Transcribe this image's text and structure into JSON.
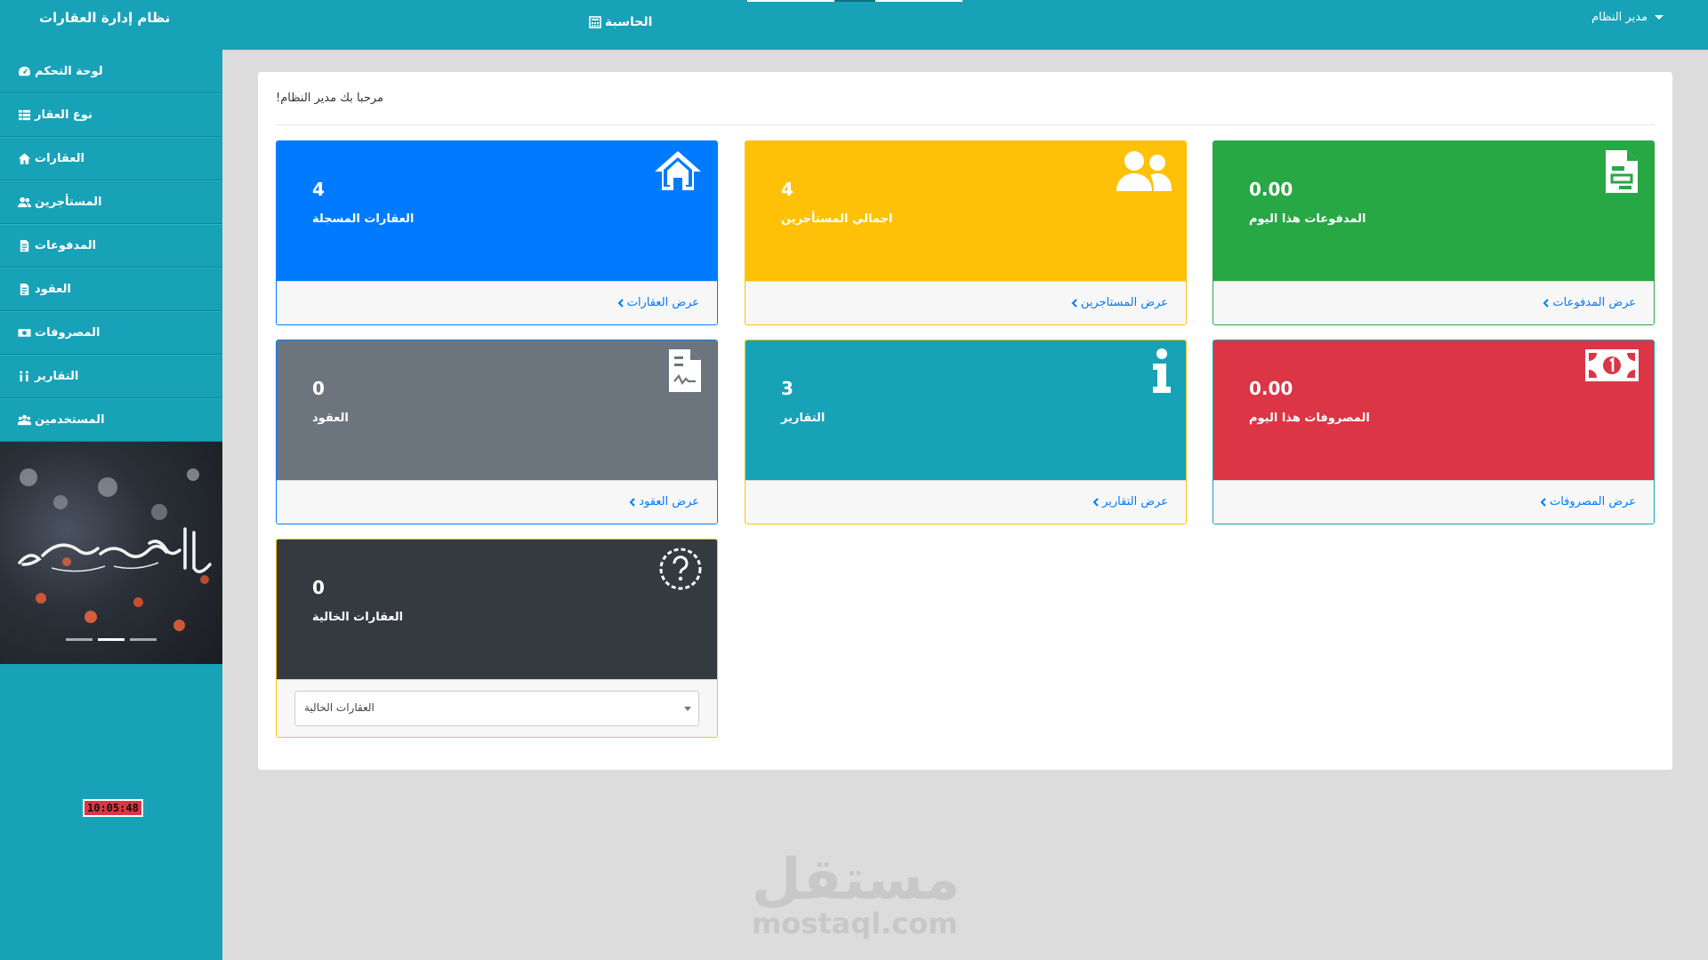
{
  "topbar": {
    "brand": "نظام إدارة العقارات",
    "calculator": "الحاسبة",
    "user": "مدير النظام",
    "colors": {
      "bar": "#17a2b8"
    }
  },
  "sidebar": {
    "items": [
      {
        "label": "لوحة التحكم",
        "icon": "dashboard-icon"
      },
      {
        "label": "نوع العقار",
        "icon": "list-icon"
      },
      {
        "label": "العقارات",
        "icon": "home-icon"
      },
      {
        "label": "المستأجرين",
        "icon": "users-icon"
      },
      {
        "label": "المدفوعات",
        "icon": "document-icon"
      },
      {
        "label": "العقود",
        "icon": "document-icon"
      },
      {
        "label": "المصروفات",
        "icon": "money-icon"
      },
      {
        "label": "التقارير",
        "icon": "info-icon"
      },
      {
        "label": "المستخدمين",
        "icon": "users-icon"
      }
    ],
    "clock": "10:05:48"
  },
  "main": {
    "welcome": "!مرحبا بك مدير النظام",
    "cards": [
      {
        "id": "registered-properties",
        "value": "4",
        "label": "العقارات المسجلة",
        "link": "عرض العقارات",
        "color": "#007bff",
        "border": "#007bff",
        "icon": "home-icon"
      },
      {
        "id": "total-tenants",
        "value": "4",
        "label": "اجمالي المستأجرين",
        "link": "عرض المستاجرين",
        "color": "#ffc107",
        "border": "#ffc107",
        "icon": "users-icon"
      },
      {
        "id": "payments-today",
        "value": "0.00",
        "label": "المدفوعات هذا اليوم",
        "link": "عرض المدفوعات",
        "color": "#28a745",
        "border": "#28a745",
        "icon": "document-icon"
      },
      {
        "id": "contracts",
        "value": "0",
        "label": "العقود",
        "link": "عرض العقود",
        "color": "#6c757d",
        "border": "#007bff",
        "icon": "contract-icon"
      },
      {
        "id": "reports",
        "value": "3",
        "label": "التقارير",
        "link": "عرض التقارير",
        "color": "#17a2b8",
        "border": "#ffc107",
        "icon": "info-icon"
      },
      {
        "id": "expenses-today",
        "value": "0.00",
        "label": "المصروفات هذا اليوم",
        "link": "عرض المصروفات",
        "color": "#dc3545",
        "border": "#17a2b8",
        "icon": "money-icon"
      },
      {
        "id": "vacant-properties",
        "value": "0",
        "label": "العقارات الخالية",
        "select": "العقارات الخالية",
        "color": "#343a40",
        "border": "#ffc107",
        "icon": "question-icon"
      }
    ]
  },
  "watermark": {
    "arabic": "مستقل",
    "latin": "mostaql.com"
  }
}
